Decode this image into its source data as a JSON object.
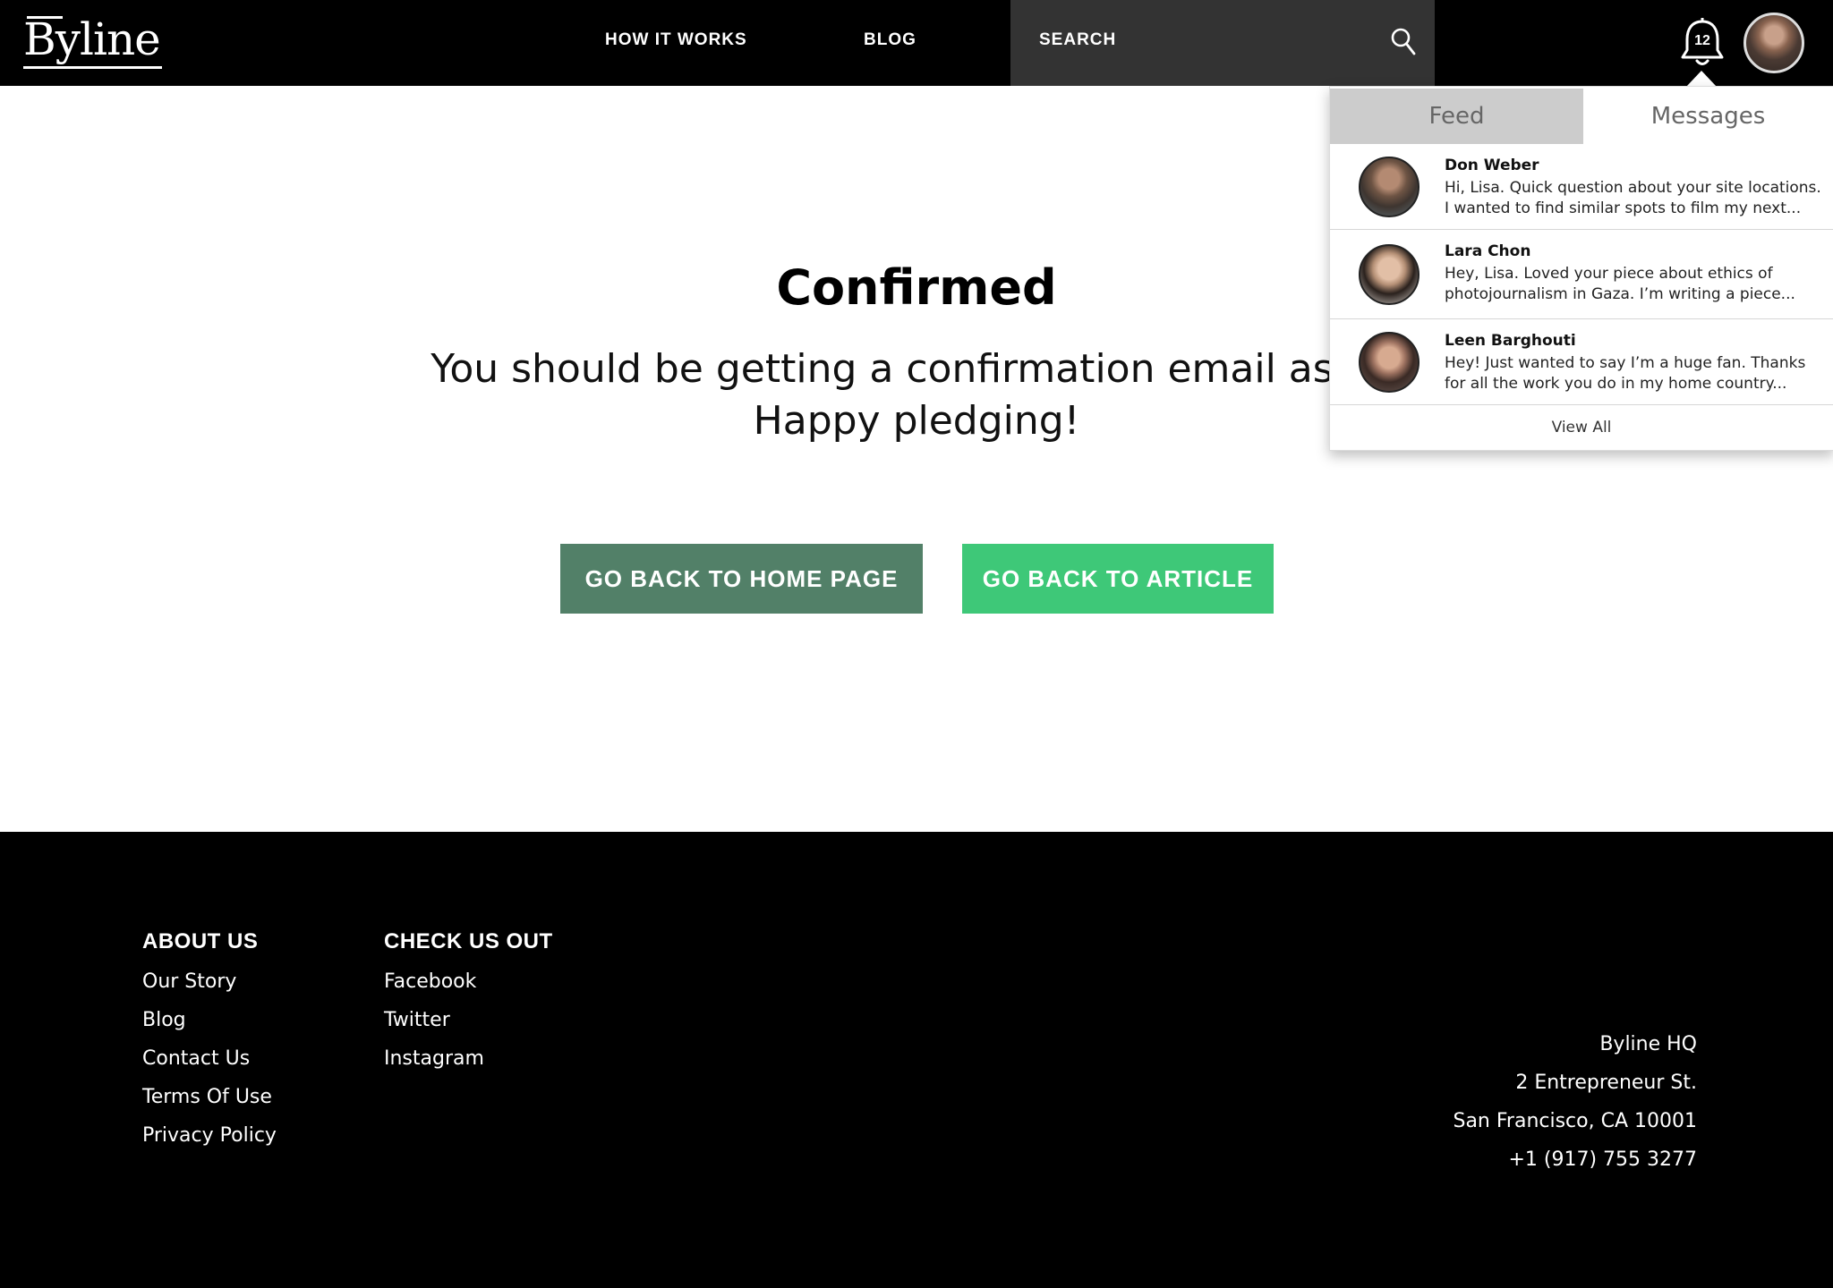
{
  "header": {
    "logo": "Byline",
    "nav": [
      {
        "label": "HOW IT WORKS"
      },
      {
        "label": "BLOG"
      }
    ],
    "search_label": "SEARCH",
    "notification_count": "12"
  },
  "main": {
    "title": "Confirmed",
    "message_line1": "You should be getting a confirmation email as we",
    "message_line2": "Happy pledging!",
    "btn_home": "GO BACK TO HOME PAGE",
    "btn_article": "GO BACK TO ARTICLE"
  },
  "dropdown": {
    "tab_feed": "Feed",
    "tab_messages": "Messages",
    "messages": [
      {
        "name": "Don Weber",
        "line1": "Hi, Lisa. Quick question about your site locations.",
        "line2": "I wanted to find similar spots to film my next..."
      },
      {
        "name": "Lara Chon",
        "line1": "Hey, Lisa. Loved your piece about ethics of",
        "line2": "photojournalism in Gaza. I’m writing a piece..."
      },
      {
        "name": "Leen Barghouti",
        "line1": "Hey! Just wanted to say I’m a huge fan. Thanks",
        "line2": "for all the work you do in my home country..."
      }
    ],
    "view_all": "View All"
  },
  "footer": {
    "about_heading": "ABOUT US",
    "about_links": [
      "Our Story",
      "Blog",
      "Contact Us",
      "Terms Of Use",
      "Privacy Policy"
    ],
    "check_heading": "CHECK US OUT",
    "check_links": [
      "Facebook",
      "Twitter",
      "Instagram"
    ],
    "address": [
      "Byline HQ",
      "2 Entrepreneur St.",
      "San Francisco, CA 10001",
      "+1 (917) 755 3277"
    ]
  },
  "colors": {
    "header_bg": "#000000",
    "search_bg": "#333333",
    "btn_home": "#528068",
    "btn_article": "#3ec878",
    "tab_feed_bg": "#cccccc"
  }
}
